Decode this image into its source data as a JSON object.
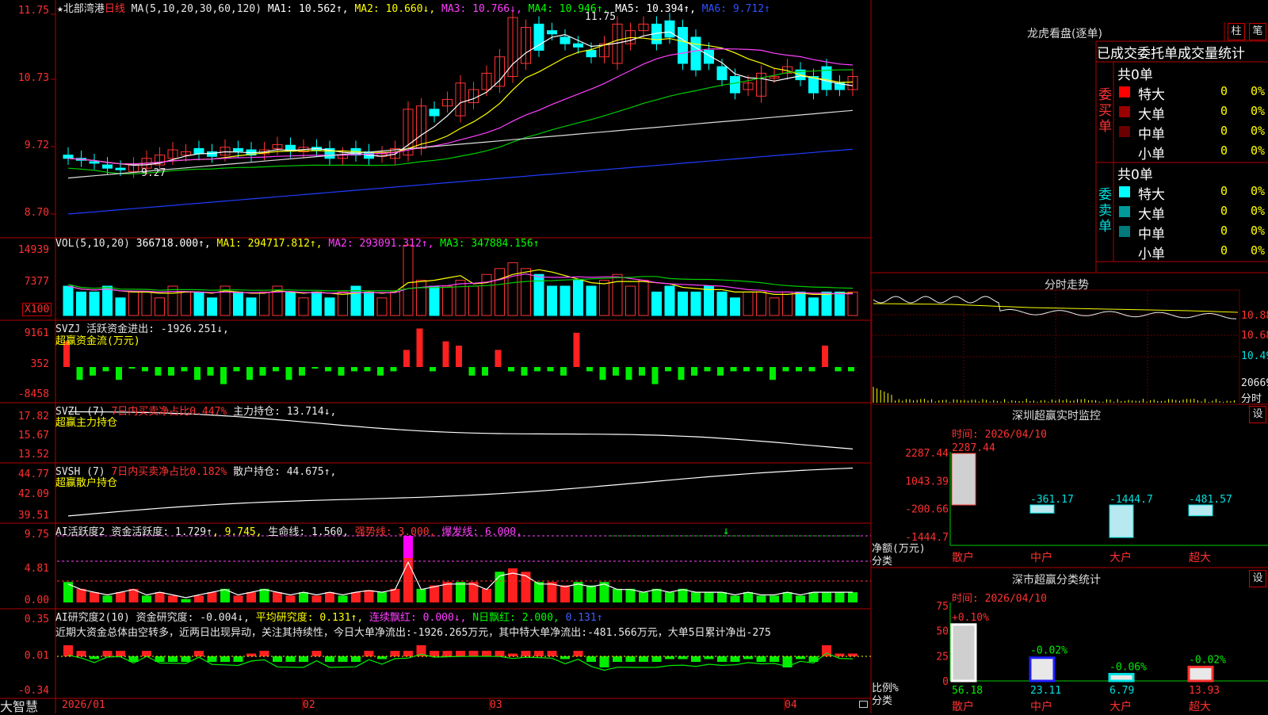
{
  "main": {
    "title": "★北部湾港",
    "period": "日线",
    "ma_label": "MA(5,10,20,30,60,120)",
    "ma_values": [
      {
        "text": "MA1: 10.562↑",
        "color": "#ffffff"
      },
      {
        "text": "MA2: 10.660↓",
        "color": "#ffff00"
      },
      {
        "text": "MA3: 10.766↓",
        "color": "#ff40ff"
      },
      {
        "text": "MA4: 10.946↑",
        "color": "#00ff00"
      },
      {
        "text": "MA5: 10.394↑",
        "color": "#ffffff"
      },
      {
        "text": "MA6: 9.712↑",
        "color": "#3050ff"
      }
    ],
    "y_ticks": [
      "11.75",
      "10.73",
      "9.72",
      "8.70"
    ],
    "high_label": "11.75",
    "low_label": "9.27"
  },
  "vol": {
    "label": "VOL(5,10,20)",
    "values": [
      {
        "text": "366718.000↑",
        "color": "#ffffff"
      },
      {
        "text": "MA1: 294717.812↑",
        "color": "#ffff00"
      },
      {
        "text": "MA2: 293091.312↑",
        "color": "#ff40ff"
      },
      {
        "text": "MA3: 347884.156↑",
        "color": "#00ff00"
      }
    ],
    "y_ticks": [
      "14939",
      "7377"
    ],
    "unit": "X100"
  },
  "svzj": {
    "label": "SVZJ",
    "line1": "活跃资金进出: -1926.251↓,",
    "line2": "超赢资金流(万元)",
    "y_ticks": [
      "9161",
      "352",
      "-8458"
    ]
  },
  "svzl": {
    "label": "SVZL (7)",
    "ratio": "7日内买卖净占比0.447%",
    "hold": "主力持仓: 13.714↓,",
    "line2": "超赢主力持仓",
    "y_ticks": [
      "17.82",
      "15.67",
      "13.52"
    ]
  },
  "svsh": {
    "label": "SVSH (7)",
    "ratio": "7日内买卖净占比0.182%",
    "hold": "散户持仓: 44.675↑,",
    "line2": "超赢散户持仓",
    "y_ticks": [
      "44.77",
      "42.09",
      "39.51"
    ]
  },
  "ai_active": {
    "label": "AI活跃度2",
    "v1": "资金活跃度: 1.729↑",
    "v2": ", 9.745,",
    "v3": "生命线: 1.560,",
    "v4": "强势线: 3.000,",
    "v5": "爆发线: 6.000,",
    "y_ticks": [
      "9.75",
      "4.81",
      "0.00"
    ]
  },
  "ai_research": {
    "label": "AI研究度2(10)",
    "v1": "资金研究度: -0.004↓,",
    "v2": "平均研究度: 0.131↑,",
    "v3": "连续飘红: 0.000↓,",
    "v4": "N日飘红: 2.000,",
    "v5": "0.131↑",
    "comment": "近期大资金总体由空转多，近两日出现异动，关注其持续性，今日大单净流出:-1926.265万元，其中特大单净流出:-481.566万元，大单5日累计净出-275",
    "y_ticks": [
      "0.35",
      "0.01",
      "-0.34"
    ]
  },
  "x_axis": [
    "2026/01",
    "02",
    "03",
    "04"
  ],
  "footer_brand": "大智慧",
  "right": {
    "lhb_title": "龙虎看盘(逐单)",
    "btn_bar": "柱",
    "btn_pen": "笔",
    "tabs": [
      "已成交",
      "委托单",
      "成交量统计"
    ],
    "buy_group": "委买单",
    "sell_group": "委卖单",
    "buy_total": "共0单",
    "sell_total": "共0单",
    "buy_rows": [
      {
        "name": "特大",
        "count": "0",
        "pct": "0%",
        "color": "#ff0000"
      },
      {
        "name": "大单",
        "count": "0",
        "pct": "0%",
        "color": "#9a0000"
      },
      {
        "name": "中单",
        "count": "0",
        "pct": "0%",
        "color": "#6a0000"
      },
      {
        "name": "小单",
        "count": "0",
        "pct": "0%",
        "color": ""
      }
    ],
    "sell_rows": [
      {
        "name": "特大",
        "count": "0",
        "pct": "0%",
        "color": "#00ffff"
      },
      {
        "name": "大单",
        "count": "0",
        "pct": "0%",
        "color": "#009a9a"
      },
      {
        "name": "中单",
        "count": "0",
        "pct": "0%",
        "color": "#007a7a"
      },
      {
        "name": "小单",
        "count": "0",
        "pct": "0%",
        "color": ""
      }
    ],
    "intraday_title": "分时走势",
    "intraday_ticks": [
      "10.88",
      "10.68",
      "10.49",
      "20669",
      "分时"
    ],
    "sz_monitor_title": "深圳超赢实时监控",
    "sz_btn": "设",
    "monitor_time": "时间: 2026/04/10",
    "monitor_yticks": [
      "2287.44",
      "1043.39",
      "-200.66",
      "-1444.7"
    ],
    "monitor_bar_labels": [
      "2287.44",
      "-361.17",
      "-1444.7",
      "-481.57"
    ],
    "monitor_values": [
      2287.44,
      -361.17,
      -1444.7,
      -481.57
    ],
    "monitor_ylabel": "净额(万元)",
    "monitor_xlabel": "分类",
    "categories": [
      "散户",
      "中户",
      "大户",
      "超大"
    ],
    "cls_title": "深市超赢分类统计",
    "cls_btn": "设",
    "cls_time": "时间: 2026/04/10",
    "cls_yticks": [
      "75",
      "50",
      "25",
      "0"
    ],
    "cls_pcts": [
      "+0.10%",
      "-0.02%",
      "-0.06%",
      "-0.02%"
    ],
    "cls_values": [
      56.18,
      23.11,
      6.79,
      13.93
    ],
    "cls_value_labels": [
      "56.18",
      "23.11",
      "6.79",
      "13.93"
    ],
    "cls_ylabel": "比例%",
    "cls_xlabel": "分类"
  }
}
